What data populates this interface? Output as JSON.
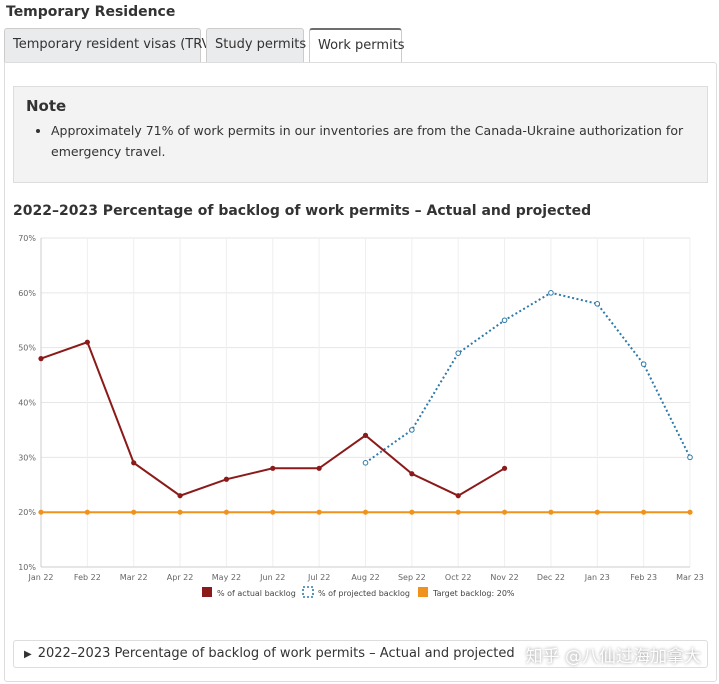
{
  "section": {
    "title": "Temporary Residence"
  },
  "tabs": [
    {
      "label": "Temporary resident visas (TRV)"
    },
    {
      "label": "Study permits"
    },
    {
      "label": "Work permits",
      "active": true
    }
  ],
  "note": {
    "heading": "Note",
    "items": [
      "Approximately 71% of work permits in our inventories are from the Canada-Ukraine authorization for emergency travel."
    ]
  },
  "details": {
    "summary": "2022–2023 Percentage of backlog of work permits – Actual and projected"
  },
  "watermark": "知乎 @八仙过海加拿大",
  "chart_data": {
    "type": "line",
    "title": "2022–2023 Percentage of backlog of work permits – Actual and projected",
    "x": [
      "Jan 22",
      "Feb 22",
      "Mar 22",
      "Apr 22",
      "May 22",
      "Jun 22",
      "Jul 22",
      "Aug 22",
      "Sep 22",
      "Oct 22",
      "Nov 22",
      "Dec 22",
      "Jan 23",
      "Feb 23",
      "Mar 23"
    ],
    "y_ticks": [
      "10%",
      "20%",
      "30%",
      "40%",
      "50%",
      "60%",
      "70%"
    ],
    "ylim": [
      10,
      70
    ],
    "grid": true,
    "legend_position": "bottom",
    "series": [
      {
        "name": "% of actual backlog",
        "color": "#8b1a1a",
        "style": "solid",
        "values": [
          48,
          51,
          29,
          23,
          26,
          28,
          28,
          34,
          27,
          23,
          28,
          null,
          null,
          null,
          null
        ]
      },
      {
        "name": "% of projected backlog",
        "color": "#2f7aa8",
        "style": "dotted",
        "values": [
          null,
          null,
          null,
          null,
          null,
          null,
          null,
          29,
          35,
          49,
          55,
          60,
          58,
          47,
          30
        ]
      },
      {
        "name": "Target backlog: 20%",
        "color": "#f0931e",
        "style": "solid",
        "values": [
          20,
          20,
          20,
          20,
          20,
          20,
          20,
          20,
          20,
          20,
          20,
          20,
          20,
          20,
          20
        ]
      }
    ]
  }
}
